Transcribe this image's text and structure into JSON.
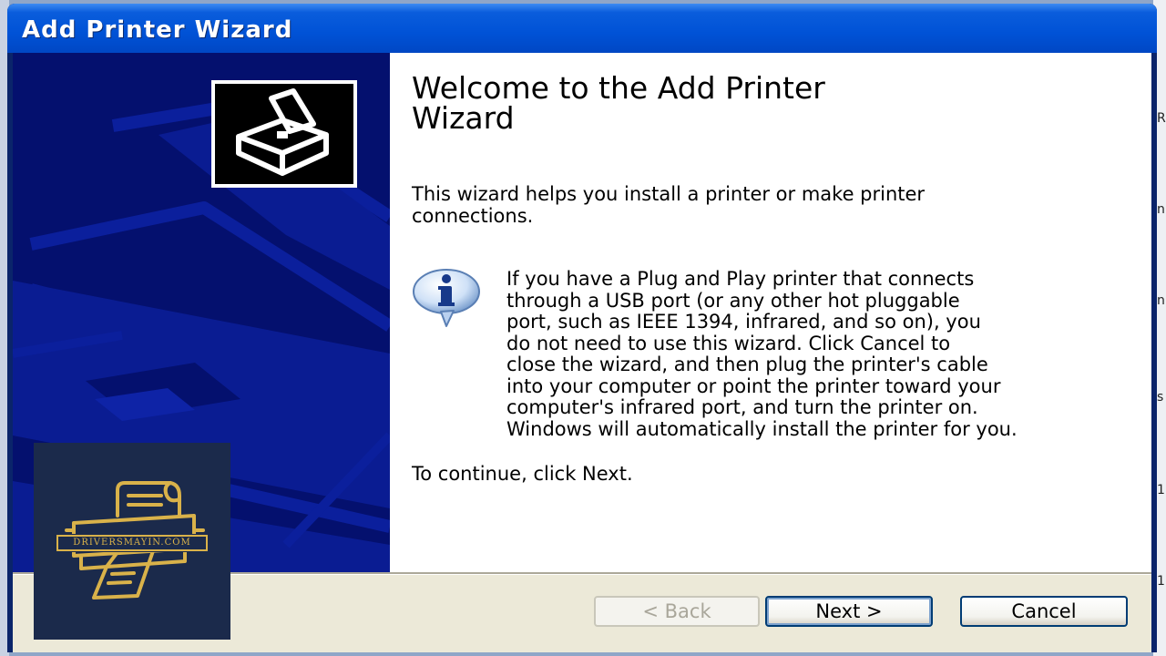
{
  "window": {
    "title": "Add Printer Wizard"
  },
  "colors": {
    "titlebar": "#0052d6",
    "banner": "#04106e",
    "content_bg": "#ffffff",
    "frame": "#ece9d8",
    "logo_bg": "#1b2a4b",
    "logo_gold": "#d9b24a"
  },
  "content": {
    "headline_line1": "Welcome to the Add Printer",
    "headline_line2": "Wizard",
    "intro_line1": "This wizard helps you install a printer or make printer",
    "intro_line2": "connections.",
    "info_lines": [
      "If you have a Plug and Play printer that connects",
      "through a USB port (or any other hot pluggable",
      "port, such as IEEE 1394, infrared, and so on), you",
      "do not need to use this wizard. Click Cancel to",
      "close the wizard, and then plug the printer's cable",
      "into your computer or point the printer toward your",
      "computer's infrared port, and turn the printer on.",
      "Windows will automatically install the printer for you."
    ],
    "continue_text": "To continue, click Next."
  },
  "icons": {
    "wizard_icon": "printer-icon",
    "info_icon": "info-icon"
  },
  "buttons": {
    "back_label": "< Back",
    "next_label": "Next >",
    "cancel_label": "Cancel"
  },
  "watermark": {
    "text": "DRIVERSMAYIN.COM"
  }
}
